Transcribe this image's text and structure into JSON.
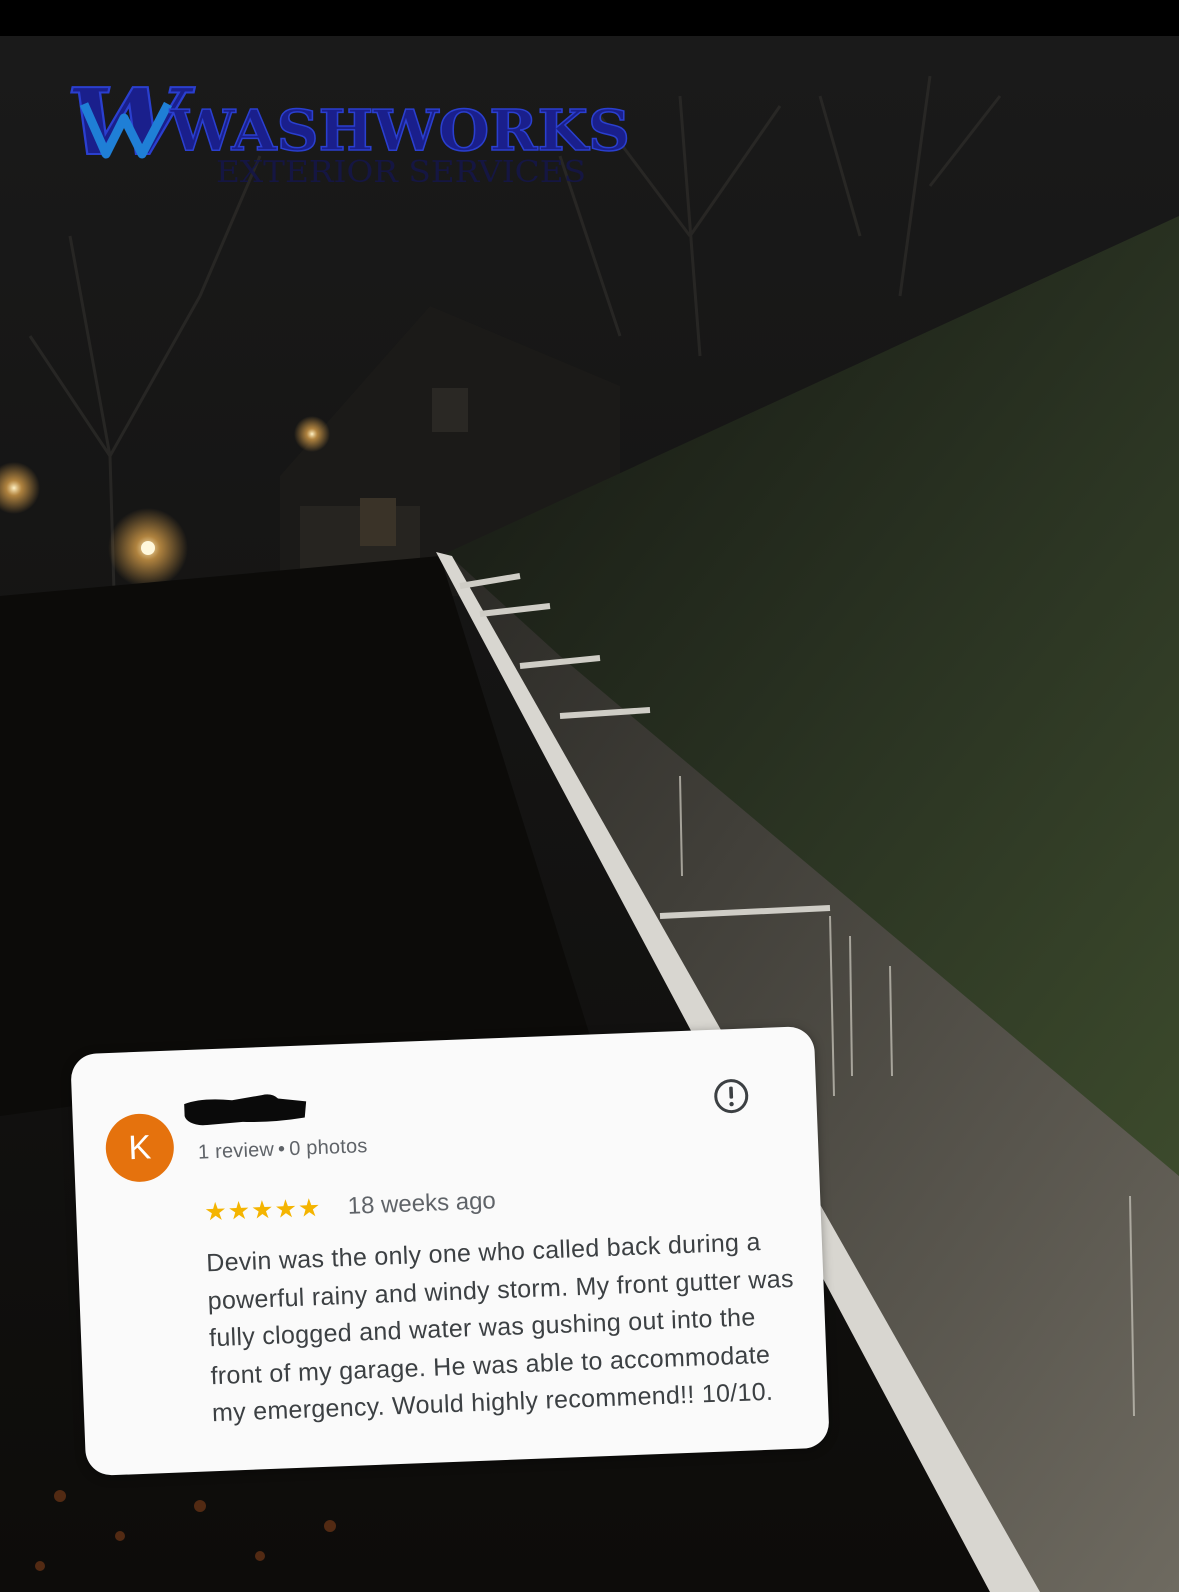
{
  "brand": {
    "name": "WASHWORKS",
    "tagline": "EXTERIOR SERVICES",
    "logo_color": "#1a1f8c",
    "accent_color": "#1f7fd6"
  },
  "review": {
    "avatar_initial": "K",
    "avatar_color": "#e5720d",
    "reviewer_name_redacted": true,
    "review_count": "1 review",
    "separator": "•",
    "photo_count": "0 photos",
    "flag_icon": "flag-report-icon",
    "rating": 5,
    "rating_max": 5,
    "stars": "★★★★★",
    "star_color": "#f4b400",
    "time_ago": "18 weeks ago",
    "text": "Devin was the only one who called back during a powerful rainy and windy storm. My front gutter was fully clogged and water was gushing out into the front of my garage. He was able to accommodate my emergency. Would highly recommend!! 10/10."
  }
}
